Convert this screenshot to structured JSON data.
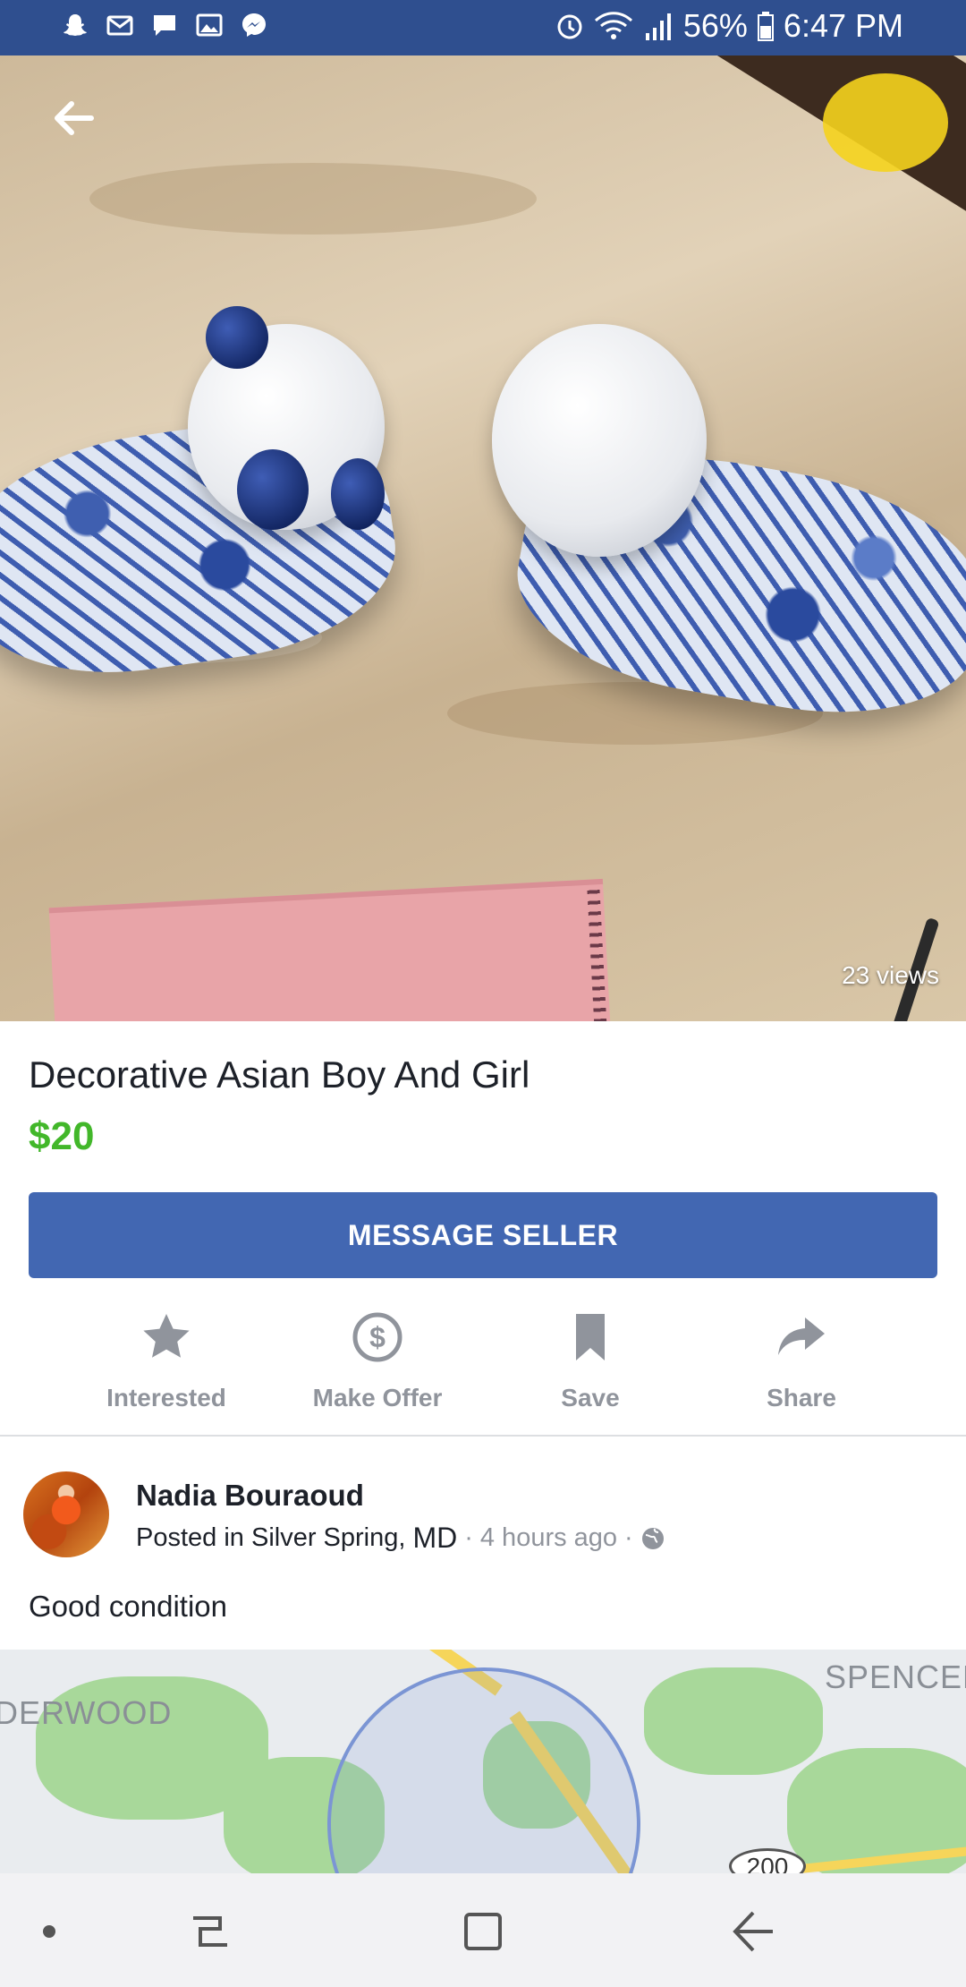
{
  "status_bar": {
    "battery": "56%",
    "time": "6:47 PM",
    "left_icons": [
      "snapchat-icon",
      "gmail-icon",
      "message-icon",
      "gallery-icon",
      "messenger-icon"
    ],
    "right_icons": [
      "alarm-icon",
      "wifi-icon",
      "signal-icon",
      "battery-icon"
    ]
  },
  "listing": {
    "views": "23 views",
    "title": "Decorative Asian Boy And Girl",
    "price": "$20",
    "message_button": "MESSAGE SELLER"
  },
  "actions": [
    {
      "label": "Interested",
      "icon": "star-icon"
    },
    {
      "label": "Make Offer",
      "icon": "dollar-circle-icon"
    },
    {
      "label": "Save",
      "icon": "bookmark-icon"
    },
    {
      "label": "Share",
      "icon": "share-arrow-icon"
    }
  ],
  "seller": {
    "name": "Nadia Bouraoud",
    "posted_prefix": "Posted in Silver Spring,",
    "state": "MD",
    "separator": "·",
    "time_ago": "4 hours ago",
    "separator2": "·"
  },
  "description": "Good condition",
  "map": {
    "label_left": "DERWOOD",
    "label_right": "SPENCER",
    "route": "200"
  },
  "colors": {
    "status_bar": "#2f4f8f",
    "accent": "#4267b2",
    "price": "#42b72a",
    "muted": "#90949c"
  }
}
